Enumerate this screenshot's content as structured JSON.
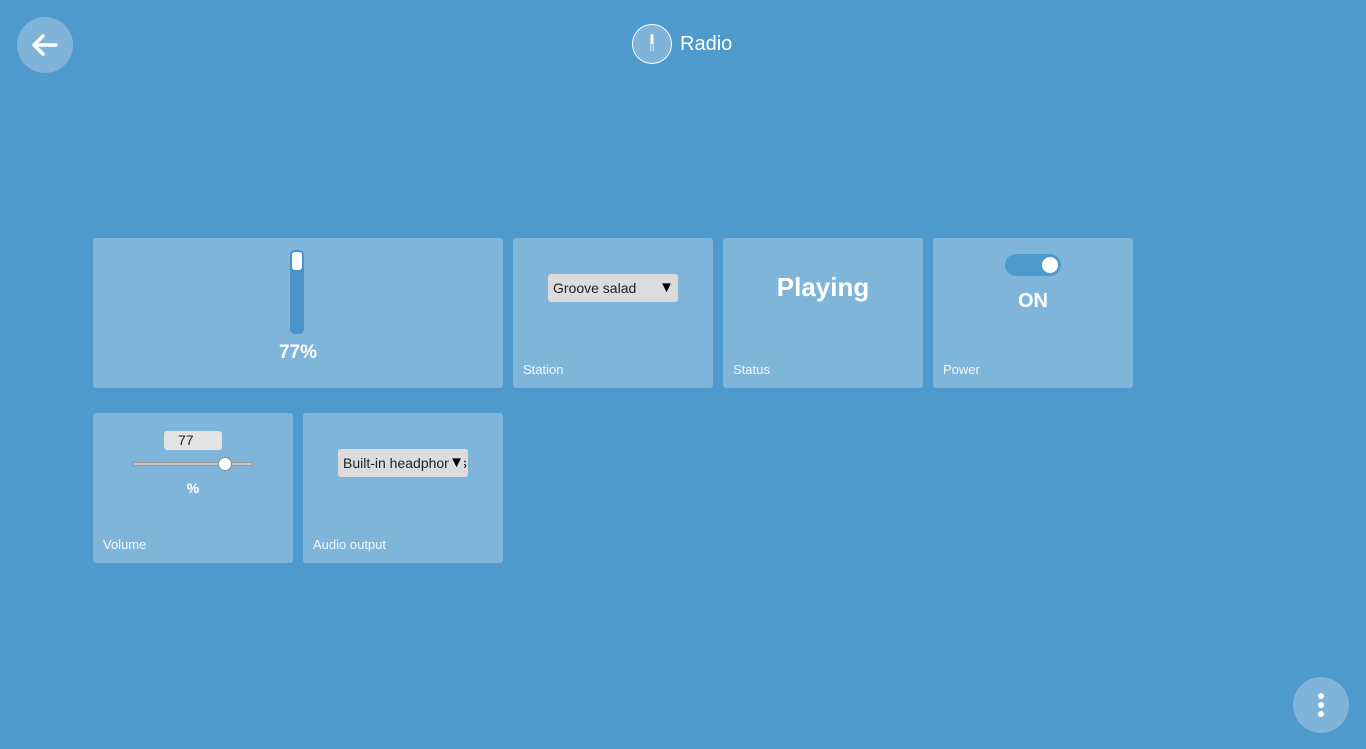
{
  "header": {
    "title": "Radio",
    "icon": "thermometer-icon"
  },
  "nav": {
    "back_icon": "arrow-left-icon",
    "menu_icon": "more-vertical-icon"
  },
  "level_tile": {
    "value_text": "77%",
    "fill_fraction": 0.77
  },
  "station_tile": {
    "selected": "Groove salad",
    "label": "Station"
  },
  "status_tile": {
    "value": "Playing",
    "label": "Status"
  },
  "power_tile": {
    "state": "ON",
    "on": true,
    "label": "Power"
  },
  "volume_tile": {
    "value": "77",
    "unit": "%",
    "slider_fraction": 0.77,
    "label": "Volume"
  },
  "audio_output_tile": {
    "selected": "Built-in headphones",
    "label": "Audio output"
  },
  "colors": {
    "background": "#4e9acc",
    "tile": "#80b5da",
    "accent": "#4a92c8"
  }
}
